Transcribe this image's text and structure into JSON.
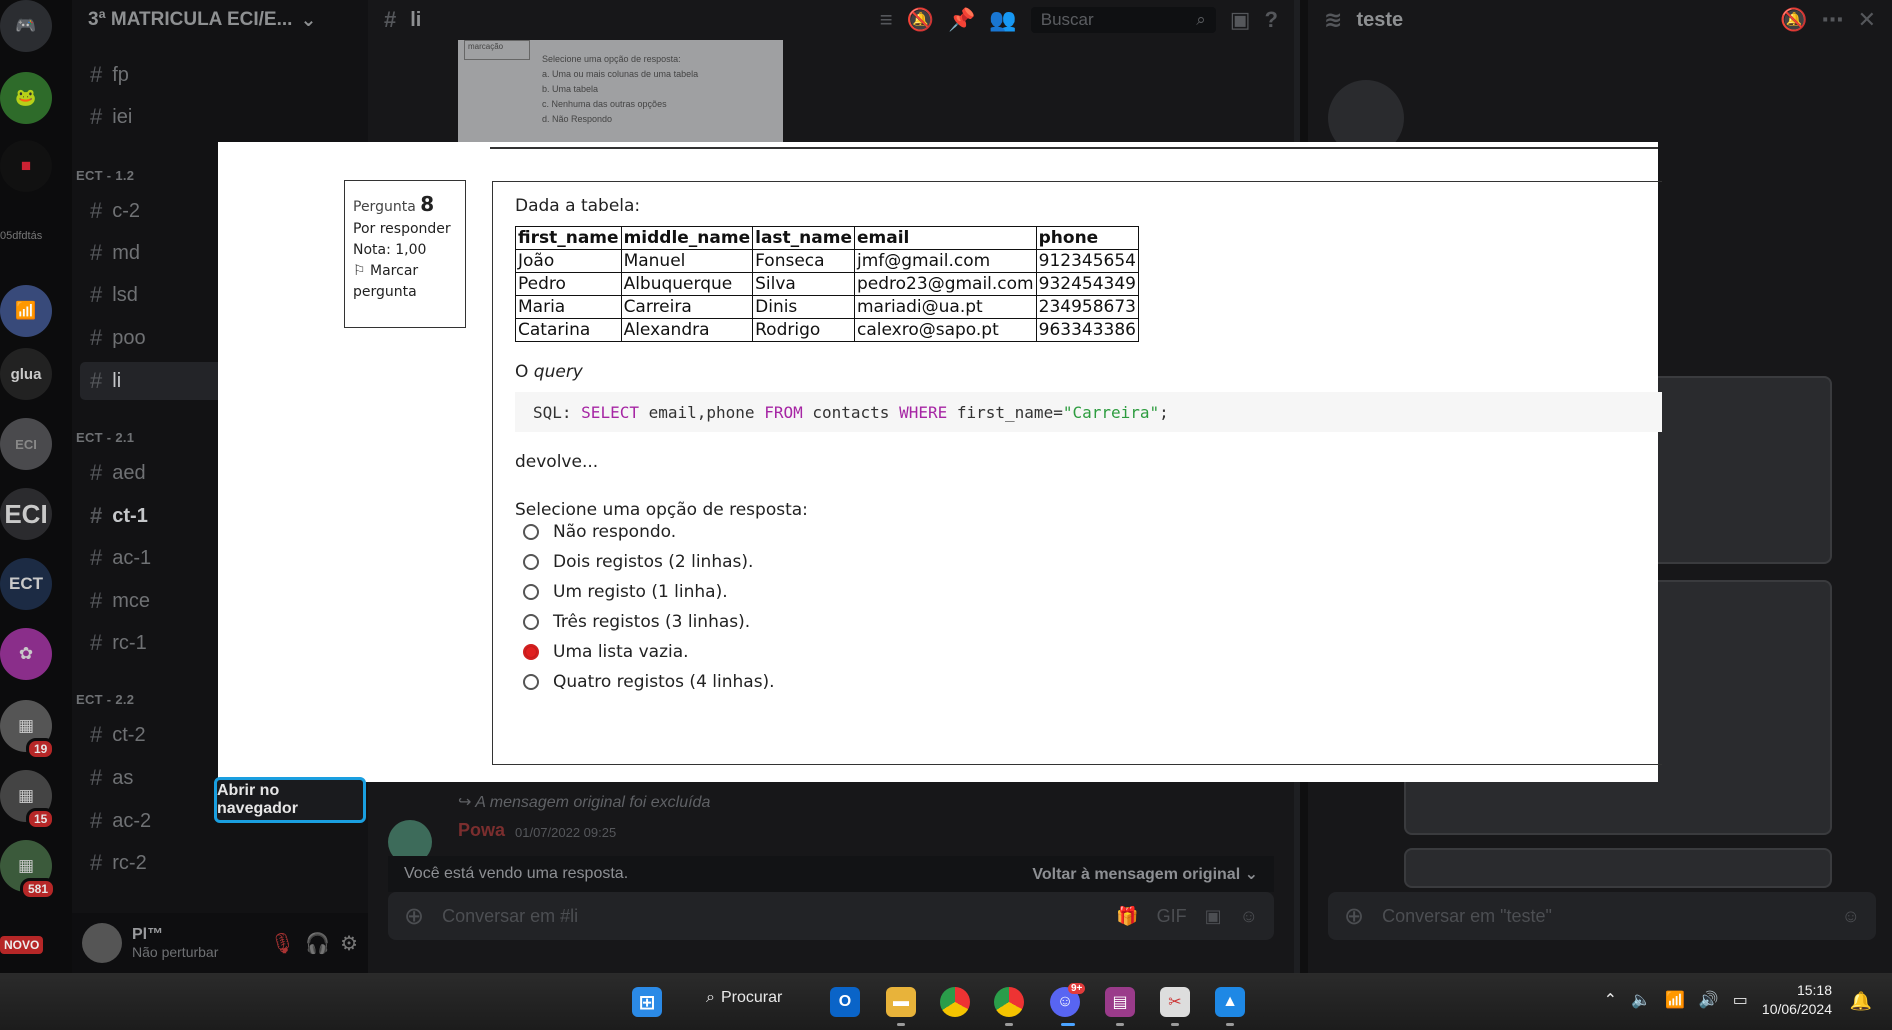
{
  "discord": {
    "server_name": "3ª MATRICULA ECI/E...",
    "server_label_small": "05dfdtás",
    "categories": [
      "ECT - 1.2",
      "ECT - 2.1",
      "ECT - 2.2"
    ],
    "channels_top": [
      "fp",
      "iei"
    ],
    "channels_cat1": [
      "c-2",
      "md",
      "lsd",
      "poo",
      "li"
    ],
    "channels_cat2": [
      "aed",
      "ct-1",
      "ac-1",
      "mce",
      "rc-1"
    ],
    "channels_cat3": [
      "ct-2",
      "as",
      "ac-2",
      "rc-2"
    ],
    "badges": [
      "19",
      "15",
      "581"
    ],
    "new_label": "NOVO",
    "user": {
      "name": "Pl™",
      "status": "Não perturbar"
    },
    "main_channel": "li",
    "search_placeholder": "Buscar",
    "thread_name": "teste",
    "deleted_msg": "A mensagem original foi excluída",
    "msg_author": "Powa",
    "msg_time": "01/07/2022 09:25",
    "reply_notice": "Você está vendo uma resposta.",
    "back_to_original": "Voltar à mensagem original",
    "composer_placeholder": "Conversar em #li",
    "thread_composer_placeholder": "Conversar em \"teste\""
  },
  "viewer": {
    "top_thumb": {
      "left_text": "marcação",
      "prompt": "Selecione uma opção de resposta:",
      "options": [
        "a.  Uma ou mais colunas de uma tabela",
        "b.  Uma tabela",
        "c.  Nenhuma das outras opções",
        "d.  Não Respondo"
      ]
    },
    "question": {
      "label": "Pergunta",
      "number": "8",
      "status": "Por responder",
      "grade": "Nota: 1,00",
      "flag": "Marcar pergunta"
    },
    "intro": "Dada a tabela:",
    "table": {
      "headers": [
        "first_name",
        "middle_name",
        "last_name",
        "email",
        "phone"
      ],
      "rows": [
        [
          "João",
          "Manuel",
          "Fonseca",
          "jmf@gmail.com",
          "912345654"
        ],
        [
          "Pedro",
          "Albuquerque",
          "Silva",
          "pedro23@gmail.com",
          "932454349"
        ],
        [
          "Maria",
          "Carreira",
          "Dinis",
          "mariadi@ua.pt",
          "234958673"
        ],
        [
          "Catarina",
          "Alexandra",
          "Rodrigo",
          "calexro@sapo.pt",
          "963343386"
        ]
      ]
    },
    "query_prefix": "O",
    "query_word": "query",
    "sql": {
      "label": "SQL: ",
      "kw_select": "SELECT",
      "cols": " email,phone ",
      "kw_from": "FROM",
      "table": " contacts ",
      "kw_where": "WHERE",
      "cond": " first_name=",
      "str": "\"Carreira\"",
      "end": ";"
    },
    "returns": "devolve...",
    "prompt": "Selecione uma opção de resposta:",
    "options": [
      {
        "label": "Não respondo.",
        "selected": false
      },
      {
        "label": "Dois registos (2 linhas).",
        "selected": false
      },
      {
        "label": "Um registo (1 linha).",
        "selected": false
      },
      {
        "label": "Três registos (3 linhas).",
        "selected": false
      },
      {
        "label": "Uma lista vazia.",
        "selected": true
      },
      {
        "label": "Quatro registos (4 linhas).",
        "selected": false
      }
    ],
    "open_browser": "Abrir no navegador"
  },
  "taskbar": {
    "search_label": "Procurar",
    "time": "15:18",
    "date": "10/06/2024",
    "discord_badge": "9+"
  }
}
